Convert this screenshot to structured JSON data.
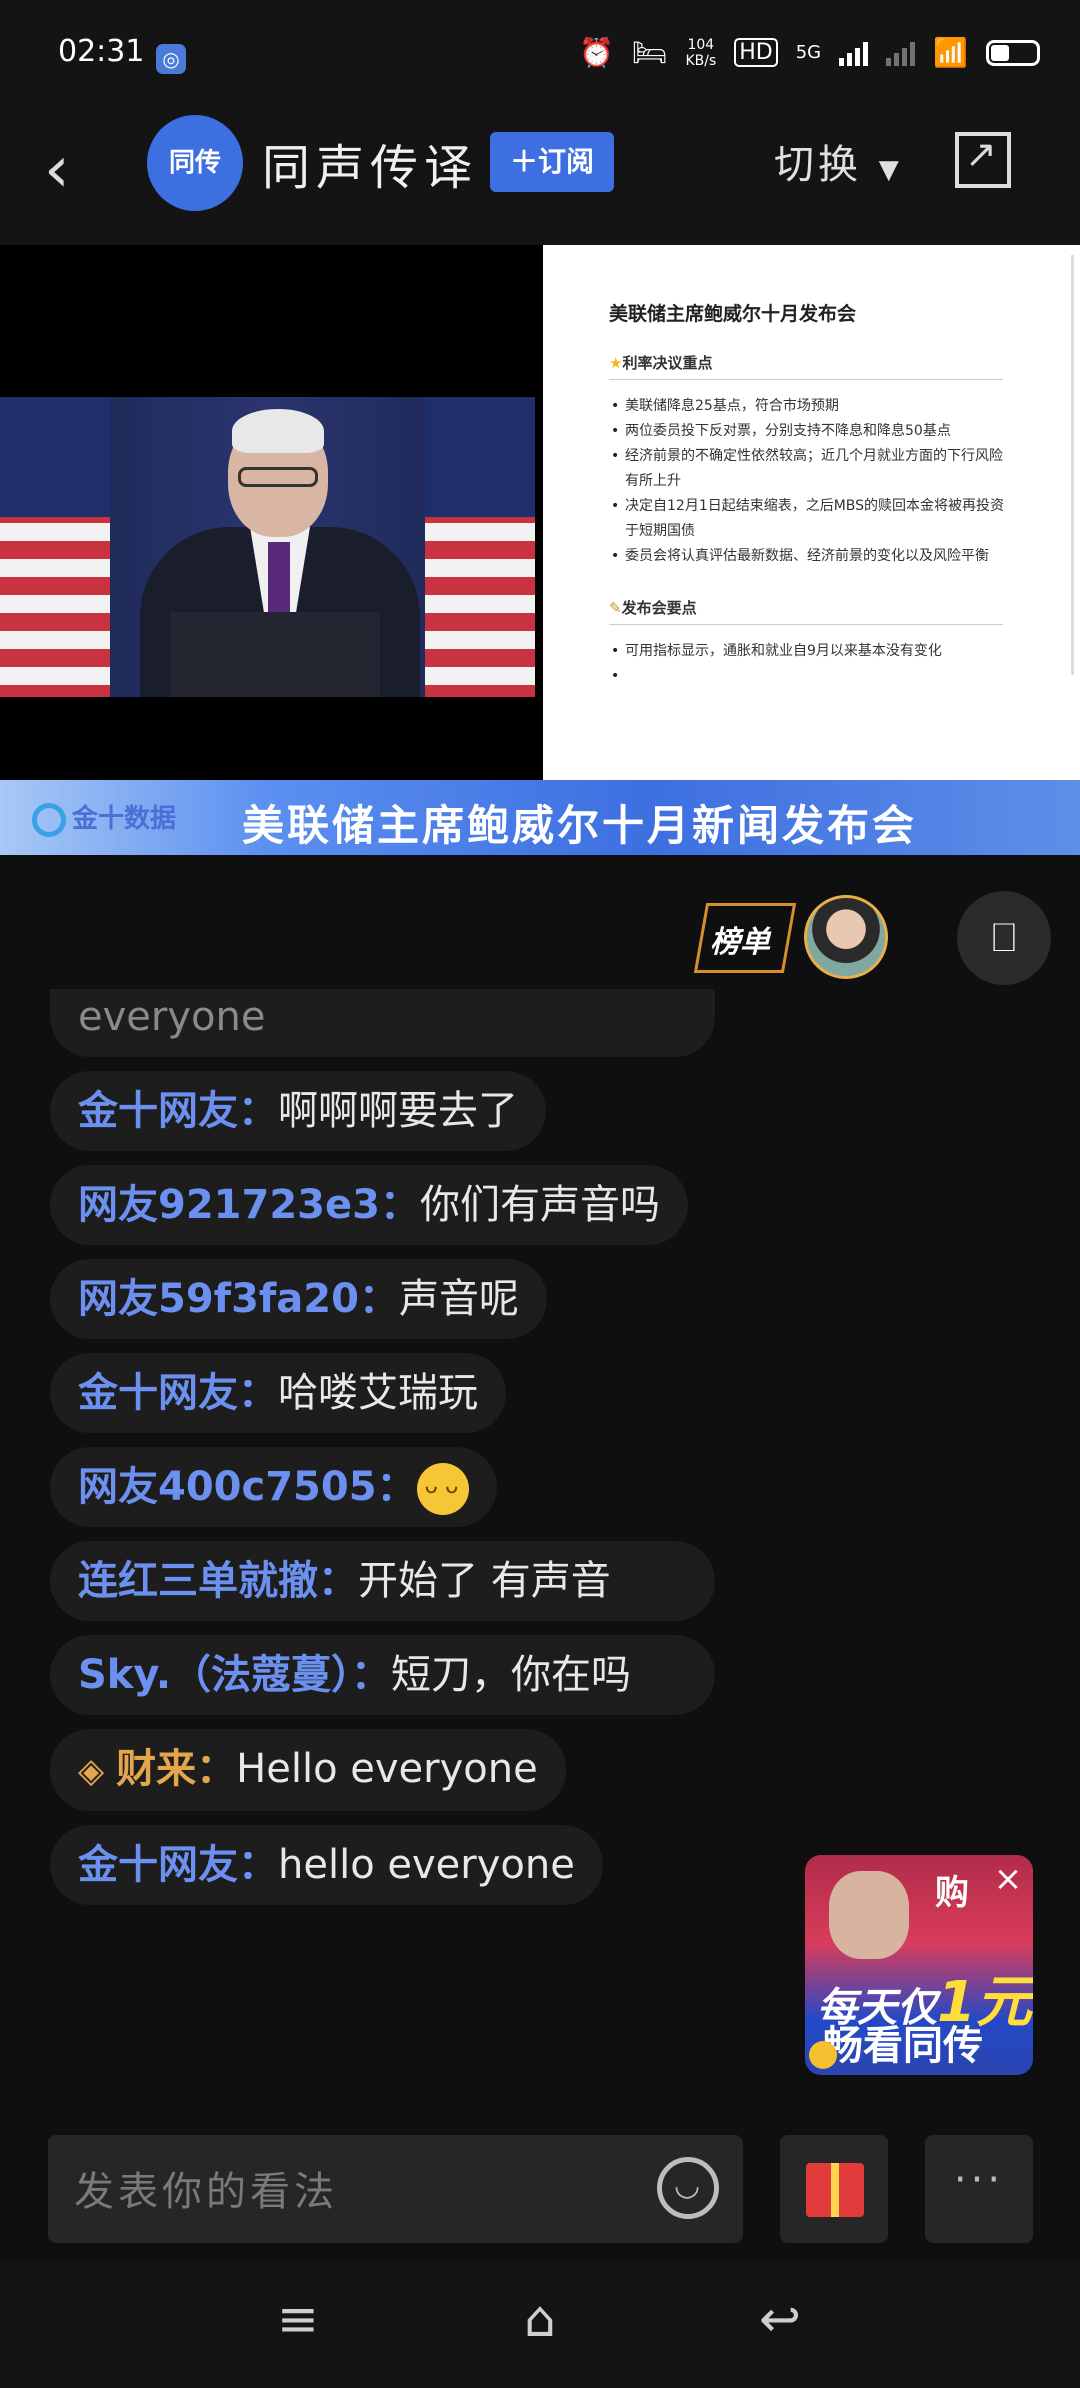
{
  "status_bar": {
    "time": "02:31",
    "net_speed_value": "104",
    "net_speed_unit": "KB/s",
    "network": "5G",
    "battery_level": 0.35
  },
  "header": {
    "logo_text": "同传",
    "title": "同声传译",
    "subscribe_label": "＋订阅",
    "switch_label": "切换"
  },
  "slide": {
    "title": "美联储主席鲍威尔十月发布会",
    "section1": "利率决议重点",
    "section1_items": [
      "美联储降息25基点，符合市场预期",
      "两位委员投下反对票，分别支持不降息和降息50基点",
      "经济前景的不确定性依然较高；近几个月就业方面的下行风险有所上升",
      "决定自12月1日起结束缩表，之后MBS的赎回本金将被再投资于短期国债",
      "委员会将认真评估最新数据、经济前景的变化以及风险平衡"
    ],
    "section2": "发布会要点",
    "section2_items": [
      "可用指标显示，通胀和就业自9月以来基本没有变化",
      ""
    ]
  },
  "banner": {
    "logo": "金十数据",
    "text": "美联储主席鲍威尔十月新闻发布会"
  },
  "chat": {
    "rank_label": "榜单",
    "partial_text": "everyone",
    "messages": [
      {
        "user": "金十网友：",
        "text": "啊啊啊要去了"
      },
      {
        "user": "网友921723e3：",
        "text": "你们有声音吗"
      },
      {
        "user": "网友59f3fa20：",
        "text": "声音呢"
      },
      {
        "user": "金十网友：",
        "text": "哈喽艾瑞玩"
      },
      {
        "user": "网友400c7505：",
        "text": ""
      },
      {
        "user": "连红三单就撤：",
        "text": "开始了 有声音"
      },
      {
        "user": "Sky.（法蔻蔓）：",
        "text": "短刀，你在吗"
      },
      {
        "user": "财来：",
        "text": "Hello everyone"
      },
      {
        "user": "金十网友：",
        "text": "hello everyone"
      }
    ]
  },
  "promo": {
    "top": "购",
    "line1_prefix": "每天仅",
    "line1_big": "1元",
    "line2": "畅看同传"
  },
  "input": {
    "placeholder": "发表你的看法",
    "more": "···"
  }
}
